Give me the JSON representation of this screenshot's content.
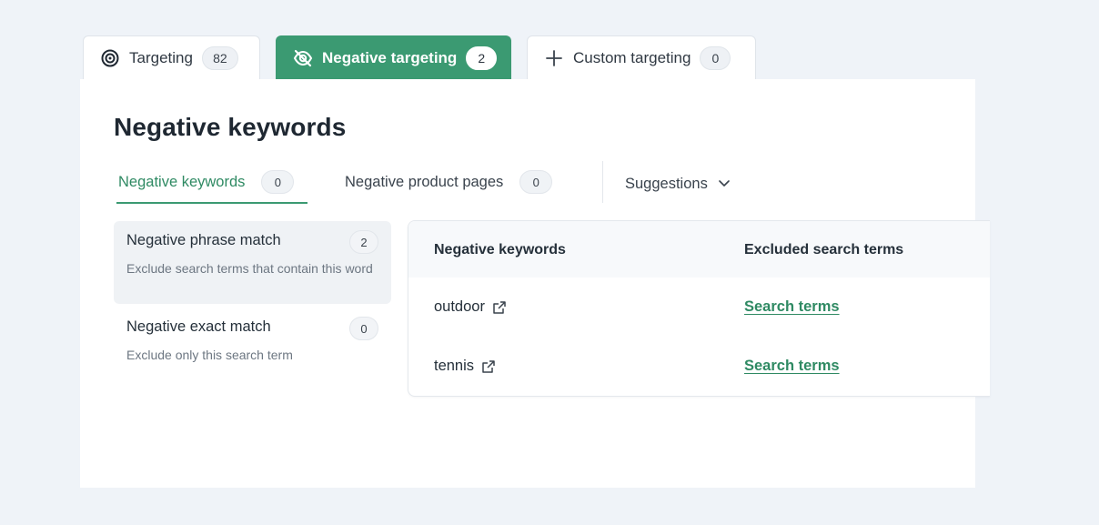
{
  "top_tabs": [
    {
      "label": "Targeting",
      "count": "82",
      "icon": "target-icon"
    },
    {
      "label": "Negative targeting",
      "count": "2",
      "icon": "eye-off-icon"
    },
    {
      "label": "Custom targeting",
      "count": "0",
      "icon": "plus-icon"
    }
  ],
  "page_title": "Negative keywords",
  "sub_tabs": [
    {
      "label": "Negative keywords",
      "count": "0"
    },
    {
      "label": "Negative product pages",
      "count": "0"
    }
  ],
  "suggestions_label": "Suggestions",
  "match_types": [
    {
      "title": "Negative phrase match",
      "count": "2",
      "description": "Exclude search terms that contain this word"
    },
    {
      "title": "Negative exact match",
      "count": "0",
      "description": "Exclude only this search term"
    }
  ],
  "table": {
    "headers": [
      "Negative keywords",
      "Excluded search terms"
    ],
    "rows": [
      {
        "keyword": "outdoor",
        "link": "Search terms"
      },
      {
        "keyword": "tennis",
        "link": "Search terms"
      }
    ]
  },
  "colors": {
    "accent": "#3b9a72",
    "link": "#2f8a63",
    "background": "#eff3f8"
  }
}
